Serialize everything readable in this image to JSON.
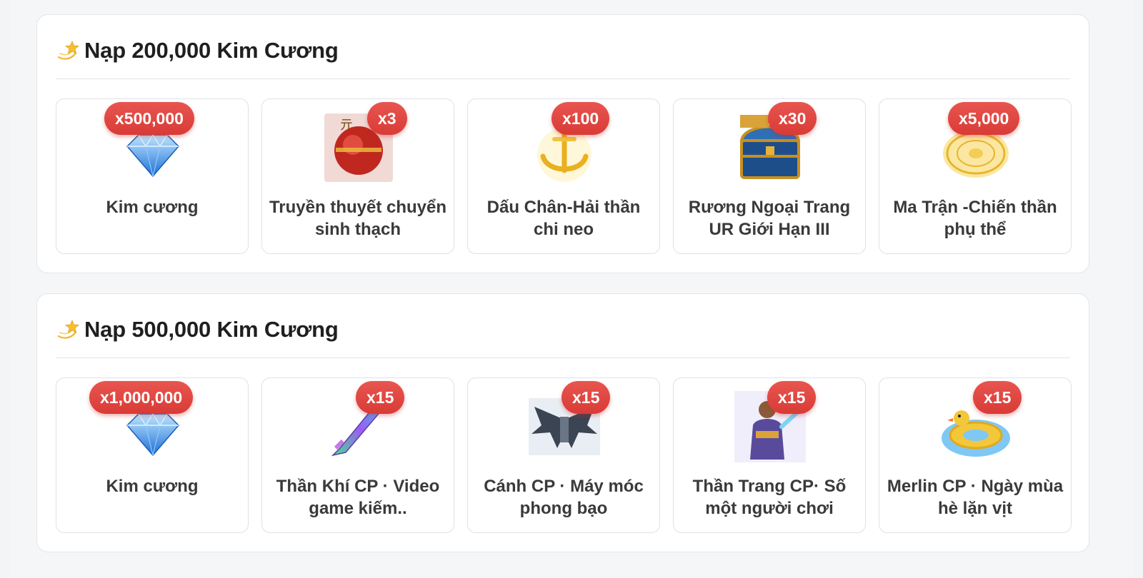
{
  "sections": [
    {
      "title": "Nạp 200,000 Kim Cương",
      "icon": "dizzy-star-icon",
      "items": [
        {
          "name": "Kim cương",
          "qty": "x500,000",
          "icon": "diamond-icon"
        },
        {
          "name": "Truyền thuyết chuyển sinh thạch",
          "qty": "x3",
          "icon": "red-orb-stone-icon"
        },
        {
          "name": "Dấu Chân-Hải thần chi neo",
          "qty": "x100",
          "icon": "golden-anchor-icon"
        },
        {
          "name": "Rương Ngoại Trang UR Giới Hạn III",
          "qty": "x30",
          "icon": "treasure-chest-icon"
        },
        {
          "name": "Ma Trận -Chiến thần phụ thể",
          "qty": "x5,000",
          "icon": "golden-magic-circle-icon"
        }
      ]
    },
    {
      "title": "Nạp 500,000 Kim Cương",
      "icon": "dizzy-star-icon",
      "items": [
        {
          "name": "Kim cương",
          "qty": "x1,000,000",
          "icon": "diamond-icon"
        },
        {
          "name": "Thần Khí CP · Video game kiếm..",
          "qty": "x15",
          "icon": "neon-sword-icon"
        },
        {
          "name": "Cánh CP · Máy móc phong bạo",
          "qty": "x15",
          "icon": "mech-wings-icon"
        },
        {
          "name": "Thần Trang CP· Số một người chơi",
          "qty": "x15",
          "icon": "armored-hero-icon"
        },
        {
          "name": "Merlin CP · Ngày mùa hè lặn vịt",
          "qty": "x15",
          "icon": "duck-float-icon"
        }
      ]
    }
  ],
  "colors": {
    "badge": "#e04a45",
    "card_border": "#dfe1e5",
    "title": "#1f1f1f"
  }
}
